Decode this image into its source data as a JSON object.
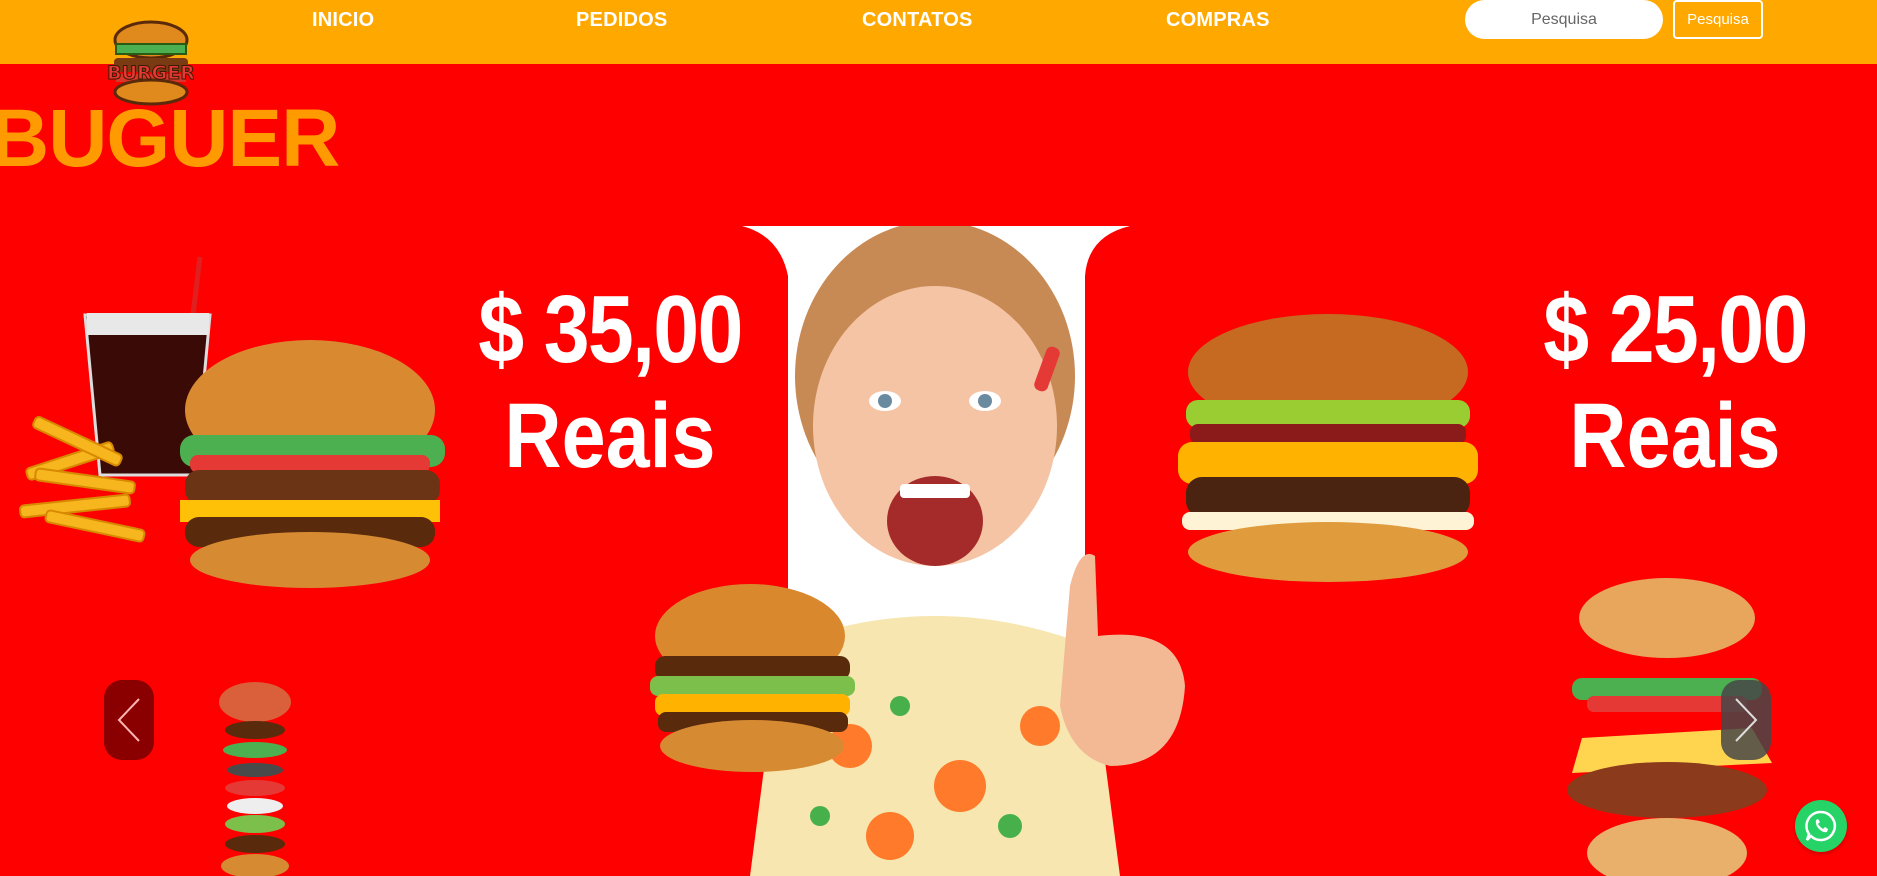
{
  "nav": {
    "items": [
      {
        "label": "INICIO"
      },
      {
        "label": "PEDIDOS"
      },
      {
        "label": "CONTATOS"
      },
      {
        "label": "COMPRAS"
      }
    ],
    "search_placeholder": "Pesquisa",
    "search_button_label": "Pesquisa"
  },
  "logo": {
    "text": "BURGER"
  },
  "hero": {
    "brand_title": "BUGUER",
    "promo_left": {
      "price": "$ 35,00",
      "unit": "Reais"
    },
    "promo_right": {
      "price": "$ 25,00",
      "unit": "Reais"
    }
  },
  "icons": [
    "chevron-left-icon",
    "chevron-right-icon",
    "whatsapp-icon"
  ],
  "colors": {
    "header": "#ffa800",
    "background": "#ff0000",
    "brand_title": "#ff9a00",
    "whatsapp": "#25d366"
  }
}
